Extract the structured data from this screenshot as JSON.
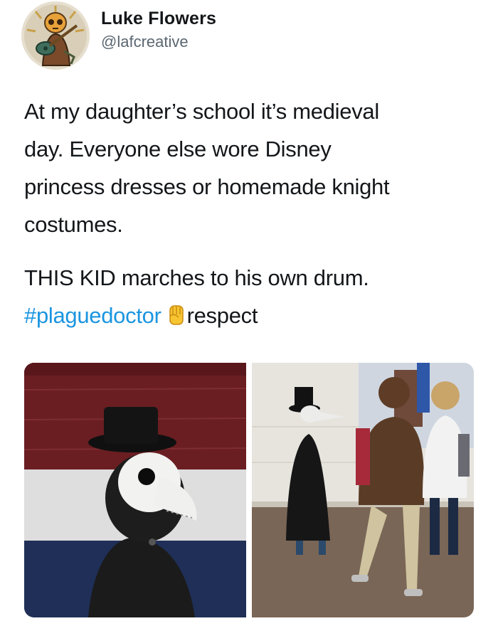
{
  "tweet": {
    "author": {
      "name": "Luke Flowers",
      "handle": "@lafcreative",
      "avatar": "skull-guitar-illustration"
    },
    "text_lines": [
      "At my daughter’s school it’s medieval",
      "day. Everyone else wore Disney",
      "princess dresses or homemade knight",
      "costumes."
    ],
    "text_line2": "THIS KID marches to his own drum.",
    "hashtag": "#plaguedoctor",
    "emoji": "raised-fist-emoji",
    "trailing_word": "respect",
    "colors": {
      "hashtag": "#1b95e0",
      "text": "#14171a",
      "handle": "#5b6670"
    },
    "media": [
      {
        "name": "plague-doctor-closeup-photo"
      },
      {
        "name": "hallway-kids-photo"
      }
    ]
  }
}
